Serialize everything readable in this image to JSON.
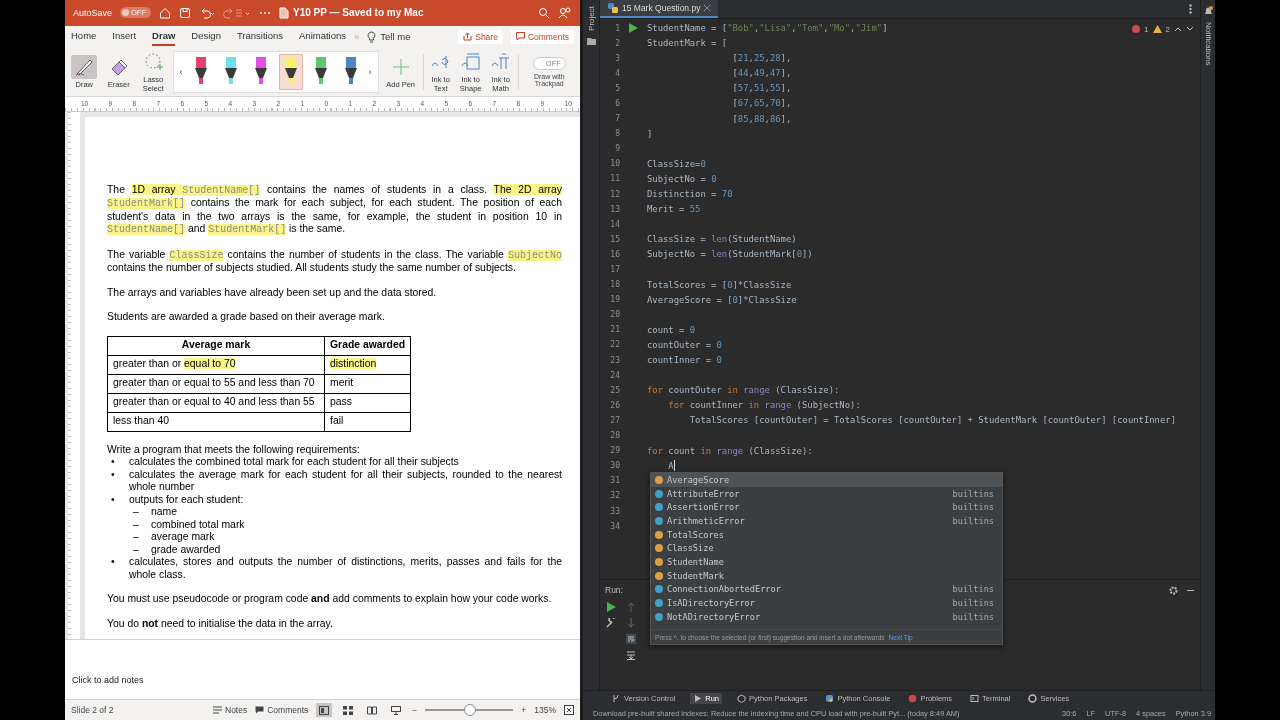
{
  "presentation": {
    "title_bar": {
      "autosave_label": "AutoSave",
      "autosave_toggle": {
        "label": "OFF",
        "on": false
      },
      "title": "Y10 PP — Saved to my Mac"
    },
    "tabs": [
      {
        "label": "Home",
        "selected": false
      },
      {
        "label": "Insert",
        "selected": false
      },
      {
        "label": "Draw",
        "selected": true
      },
      {
        "label": "Design",
        "selected": false
      },
      {
        "label": "Transitions",
        "selected": false
      },
      {
        "label": "Animations",
        "selected": false
      }
    ],
    "tabs_overflow": "»",
    "tell_me": "Tell me",
    "share": "Share",
    "comments": "Comments",
    "ribbon": {
      "tools": [
        {
          "kind": "draw",
          "label": "Draw",
          "selected": true
        },
        {
          "kind": "eraser",
          "label": "Eraser",
          "selected": false
        },
        {
          "kind": "lasso",
          "label": "Lasso Select",
          "selected": false
        }
      ],
      "pens": [
        {
          "color": "#e8416f",
          "selected": false
        },
        {
          "color": "#6fe0ea",
          "selected": false
        },
        {
          "color": "#e24de8",
          "selected": false
        },
        {
          "color": "#f7f267",
          "selected": true
        },
        {
          "color": "#5cc66a",
          "selected": false
        },
        {
          "color": "#4a86c6",
          "selected": false
        }
      ],
      "pen_scroll_left": "‹",
      "pen_scroll_right": "›",
      "add_pen": "Add Pen",
      "ink_tools": [
        {
          "kind": "text",
          "label": "Ink to Text"
        },
        {
          "kind": "shape",
          "label": "Ink to Shape"
        },
        {
          "kind": "math",
          "label": "Ink to Math"
        }
      ],
      "trackpad_toggle": {
        "label": "OFF",
        "on": false
      },
      "trackpad_label": "Draw with Trackpad"
    },
    "ruler": [
      "10",
      "9",
      "8",
      "7",
      "6",
      "5",
      "4",
      "3",
      "2",
      "1",
      "0",
      "1",
      "2",
      "3",
      "4",
      "5",
      "6",
      "7",
      "8",
      "9",
      "10"
    ],
    "slide": {
      "paragraphs": [
        [
          {
            "kind": "text",
            "text": "The ",
            "highlighted": false
          },
          {
            "kind": "text",
            "text": "1D array ",
            "highlighted": true
          },
          {
            "kind": "code",
            "text": "StudentName[]",
            "highlighted": true
          },
          {
            "kind": "text",
            "text": " contains the names of students in a class. ",
            "highlighted": false
          },
          {
            "kind": "text",
            "text": "The 2D array ",
            "highlighted": true
          },
          {
            "kind": "code",
            "text": "StudentMark[]",
            "highlighted": true
          },
          {
            "kind": "text",
            "text": " contains the mark for each subject, for each student. The position of each student's data in the two arrays is the same, for example, the student in position 10 in ",
            "highlighted": false
          },
          {
            "kind": "code",
            "text": "StudentName[]",
            "highlighted": true
          },
          {
            "kind": "text",
            "text": " and ",
            "highlighted": false
          },
          {
            "kind": "code",
            "text": "StudentMark[]",
            "highlighted": true
          },
          {
            "kind": "text",
            "text": " is the same.",
            "highlighted": false
          }
        ],
        [
          {
            "kind": "text",
            "text": "The variable ",
            "highlighted": false
          },
          {
            "kind": "code",
            "text": "ClassSize",
            "highlighted": true
          },
          {
            "kind": "text",
            "text": " contains the number of students in the class. The variable ",
            "highlighted": false
          },
          {
            "kind": "code",
            "text": "SubjectNo",
            "highlighted": true
          },
          {
            "kind": "text",
            "text": " contains the number of subjects studied. All students study the same number of subjects.",
            "highlighted": false
          }
        ],
        [
          {
            "kind": "text",
            "text": "The arrays and variables have already been set up and the data stored.",
            "highlighted": false
          }
        ],
        [
          {
            "kind": "text",
            "text": "Students are awarded a grade based on their average mark.",
            "highlighted": false
          }
        ]
      ],
      "table": {
        "columns": [
          "Average mark",
          "Grade awarded"
        ],
        "rows": [
          [
            [
              {
                "kind": "text",
                "text": "greater than or ",
                "highlighted": false
              },
              {
                "kind": "text",
                "text": "equal to 70",
                "highlighted": true
              }
            ],
            [
              {
                "kind": "text",
                "text": "distinction",
                "highlighted": true
              }
            ]
          ],
          [
            [
              {
                "kind": "text",
                "text": "greater than or equal to 55 and less than 70",
                "highlighted": false
              }
            ],
            [
              {
                "kind": "text",
                "text": "merit",
                "highlighted": false
              }
            ]
          ],
          [
            [
              {
                "kind": "text",
                "text": "greater than or equal to 40 and less than 55",
                "highlighted": false
              }
            ],
            [
              {
                "kind": "text",
                "text": "pass",
                "highlighted": false
              }
            ]
          ],
          [
            [
              {
                "kind": "text",
                "text": "less than 40",
                "highlighted": false
              }
            ],
            [
              {
                "kind": "text",
                "text": "fail",
                "highlighted": false
              }
            ]
          ]
        ]
      },
      "requirements": {
        "intro": "Write a program that meets the following requirements:",
        "items": [
          {
            "marker": "•",
            "text": "calculates the combined total mark for each student for all their subjects"
          },
          {
            "marker": "•",
            "text": "calculates the average mark for each student for all their subjects, rounded to the nearest whole number"
          },
          {
            "marker": "•",
            "text": "outputs for each student:",
            "children": [
              {
                "marker": "–",
                "text": "name"
              },
              {
                "marker": "–",
                "text": "combined total mark"
              },
              {
                "marker": "–",
                "text": "average mark"
              },
              {
                "marker": "–",
                "text": "grade awarded"
              }
            ]
          },
          {
            "marker": "•",
            "text": "calculates, stores and outputs the number of distinctions, merits, passes and fails for the whole class."
          }
        ]
      },
      "closing": [
        "You must use pseudocode or program code **and** add comments to explain how your code works.",
        "You do **not** need to initialise the data in the array."
      ]
    },
    "notes_placeholder": "Click to add notes",
    "status_bar": {
      "slide": "Slide 2 of 2",
      "notes": "Notes",
      "comments": "Comments",
      "views": [
        {
          "kind": "normal",
          "selected": true
        },
        {
          "kind": "sorter",
          "selected": false
        },
        {
          "kind": "reading",
          "selected": false
        },
        {
          "kind": "show",
          "selected": false
        }
      ],
      "zoom_out": "−",
      "zoom_in": "+",
      "zoom_slider": {
        "level": 0.5
      },
      "zoom": "135%"
    }
  },
  "ide": {
    "side_left": "Project",
    "side_right": "Notifications",
    "file_tab": "15 Mark Question.py",
    "inspections": {
      "errors": "1",
      "warnings": "2"
    },
    "code_lines": [
      {
        "number": "1",
        "tokens": [
          {
            "kind": "plain",
            "text": "StudentName = ["
          },
          {
            "kind": "string",
            "text": "\"Bob\""
          },
          {
            "kind": "plain",
            "text": ","
          },
          {
            "kind": "string",
            "text": "\"Lisa\""
          },
          {
            "kind": "plain",
            "text": ","
          },
          {
            "kind": "string",
            "text": "\"Tom\""
          },
          {
            "kind": "plain",
            "text": ","
          },
          {
            "kind": "string",
            "text": "\"Mo\""
          },
          {
            "kind": "plain",
            "text": ","
          },
          {
            "kind": "string",
            "text": "\"Jim\""
          },
          {
            "kind": "plain",
            "text": "]"
          }
        ]
      },
      {
        "number": "2",
        "tokens": [
          {
            "kind": "plain",
            "text": "StudentMark = ["
          }
        ]
      },
      {
        "number": "3",
        "tokens": [
          {
            "kind": "plain",
            "text": "                ["
          },
          {
            "kind": "number",
            "text": "21"
          },
          {
            "kind": "plain",
            "text": ","
          },
          {
            "kind": "number",
            "text": "25"
          },
          {
            "kind": "plain",
            "text": ","
          },
          {
            "kind": "number",
            "text": "28"
          },
          {
            "kind": "plain",
            "text": "],"
          }
        ]
      },
      {
        "number": "4",
        "tokens": [
          {
            "kind": "plain",
            "text": "                ["
          },
          {
            "kind": "number",
            "text": "44"
          },
          {
            "kind": "plain",
            "text": ","
          },
          {
            "kind": "number",
            "text": "49"
          },
          {
            "kind": "plain",
            "text": ","
          },
          {
            "kind": "number",
            "text": "47"
          },
          {
            "kind": "plain",
            "text": "],"
          }
        ]
      },
      {
        "number": "5",
        "tokens": [
          {
            "kind": "plain",
            "text": "                ["
          },
          {
            "kind": "number",
            "text": "57"
          },
          {
            "kind": "plain",
            "text": ","
          },
          {
            "kind": "number",
            "text": "51"
          },
          {
            "kind": "plain",
            "text": ","
          },
          {
            "kind": "number",
            "text": "55"
          },
          {
            "kind": "plain",
            "text": "],"
          }
        ]
      },
      {
        "number": "6",
        "tokens": [
          {
            "kind": "plain",
            "text": "                ["
          },
          {
            "kind": "number",
            "text": "67"
          },
          {
            "kind": "plain",
            "text": ","
          },
          {
            "kind": "number",
            "text": "65"
          },
          {
            "kind": "plain",
            "text": ","
          },
          {
            "kind": "number",
            "text": "70"
          },
          {
            "kind": "plain",
            "text": "],"
          }
        ]
      },
      {
        "number": "7",
        "tokens": [
          {
            "kind": "plain",
            "text": "                ["
          },
          {
            "kind": "number",
            "text": "85"
          },
          {
            "kind": "plain",
            "text": ","
          },
          {
            "kind": "number",
            "text": "88"
          },
          {
            "kind": "plain",
            "text": ","
          },
          {
            "kind": "number",
            "text": "86"
          },
          {
            "kind": "plain",
            "text": "],"
          }
        ]
      },
      {
        "number": "8",
        "tokens": [
          {
            "kind": "plain",
            "text": "]"
          }
        ]
      },
      {
        "number": "9"
      },
      {
        "number": "10",
        "tokens": [
          {
            "kind": "plain",
            "text": "ClassSize="
          },
          {
            "kind": "number",
            "text": "0"
          }
        ]
      },
      {
        "number": "11",
        "tokens": [
          {
            "kind": "plain",
            "text": "SubjectNo = "
          },
          {
            "kind": "number",
            "text": "0"
          }
        ]
      },
      {
        "number": "12",
        "tokens": [
          {
            "kind": "plain",
            "text": "Distinction = "
          },
          {
            "kind": "number",
            "text": "70"
          }
        ]
      },
      {
        "number": "13",
        "tokens": [
          {
            "kind": "plain",
            "text": "Merit = "
          },
          {
            "kind": "number",
            "text": "55"
          }
        ]
      },
      {
        "number": "14"
      },
      {
        "number": "15",
        "tokens": [
          {
            "kind": "plain",
            "text": "ClassSize = "
          },
          {
            "kind": "builtin",
            "text": "len"
          },
          {
            "kind": "plain",
            "text": "(StudentName)"
          }
        ]
      },
      {
        "number": "16",
        "tokens": [
          {
            "kind": "plain",
            "text": "SubjectNo = "
          },
          {
            "kind": "builtin",
            "text": "len"
          },
          {
            "kind": "plain",
            "text": "(StudentMark["
          },
          {
            "kind": "number",
            "text": "0"
          },
          {
            "kind": "plain",
            "text": "])"
          }
        ]
      },
      {
        "number": "17"
      },
      {
        "number": "18",
        "tokens": [
          {
            "kind": "plain",
            "text": "TotalScores = ["
          },
          {
            "kind": "number",
            "text": "0"
          },
          {
            "kind": "plain",
            "text": "]*ClassSize"
          }
        ]
      },
      {
        "number": "19",
        "tokens": [
          {
            "kind": "plain",
            "text": "AverageScore = ["
          },
          {
            "kind": "number",
            "text": "0"
          },
          {
            "kind": "plain",
            "text": "]*ClassSize"
          }
        ]
      },
      {
        "number": "20"
      },
      {
        "number": "21",
        "tokens": [
          {
            "kind": "plain",
            "text": "count = "
          },
          {
            "kind": "number",
            "text": "0"
          }
        ]
      },
      {
        "number": "22",
        "tokens": [
          {
            "kind": "plain",
            "text": "countOuter = "
          },
          {
            "kind": "number",
            "text": "0"
          }
        ]
      },
      {
        "number": "23",
        "tokens": [
          {
            "kind": "plain",
            "text": "countInner = "
          },
          {
            "kind": "number",
            "text": "0"
          }
        ]
      },
      {
        "number": "24"
      },
      {
        "number": "25",
        "tokens": [
          {
            "kind": "keyword",
            "text": "for"
          },
          {
            "kind": "plain",
            "text": " countOuter "
          },
          {
            "kind": "keyword",
            "text": "in"
          },
          {
            "kind": "builtin",
            "text": " range"
          },
          {
            "kind": "plain",
            "text": " (ClassSize):"
          }
        ]
      },
      {
        "number": "26",
        "tokens": [
          {
            "kind": "keyword",
            "text": "    for"
          },
          {
            "kind": "plain",
            "text": " countInner "
          },
          {
            "kind": "keyword",
            "text": "in"
          },
          {
            "kind": "builtin",
            "text": " range"
          },
          {
            "kind": "plain",
            "text": " (SubjectNo):"
          }
        ]
      },
      {
        "number": "27",
        "tokens": [
          {
            "kind": "plain",
            "text": "        TotalScores [countOuter] = TotalScores [countOuter] + StudentMark [countOuter] [countInner]"
          }
        ]
      },
      {
        "number": "28"
      },
      {
        "number": "29",
        "tokens": [
          {
            "kind": "keyword",
            "text": "for"
          },
          {
            "kind": "plain",
            "text": " count "
          },
          {
            "kind": "keyword",
            "text": "in"
          },
          {
            "kind": "builtin",
            "text": " range"
          },
          {
            "kind": "plain",
            "text": " (ClassSize):"
          }
        ]
      },
      {
        "number": "30",
        "tokens": [
          {
            "kind": "plain",
            "text": "    A"
          }
        ]
      },
      {
        "number": "31"
      },
      {
        "number": "32"
      },
      {
        "number": "33"
      },
      {
        "number": "34"
      }
    ],
    "completion": {
      "items": [
        {
          "kind": "variable",
          "name": "AverageScore",
          "selected": true
        },
        {
          "kind": "class",
          "name": "AttributeError",
          "source": "builtins",
          "selected": false
        },
        {
          "kind": "class",
          "name": "AssertionError",
          "source": "builtins",
          "selected": false
        },
        {
          "kind": "class",
          "name": "ArithmeticError",
          "source": "builtins",
          "selected": false
        },
        {
          "kind": "variable",
          "name": "TotalScores",
          "selected": false
        },
        {
          "kind": "variable",
          "name": "ClassSize",
          "selected": false
        },
        {
          "kind": "variable",
          "name": "StudentName",
          "selected": false
        },
        {
          "kind": "variable",
          "name": "StudentMark",
          "selected": false
        },
        {
          "kind": "class",
          "name": "ConnectionAbortedError",
          "source": "builtins",
          "selected": false
        },
        {
          "kind": "class",
          "name": "IsADirectoryError",
          "source": "builtins",
          "selected": false
        },
        {
          "kind": "class",
          "name": "NotADirectoryError",
          "source": "builtins",
          "selected": false
        }
      ],
      "hint": "Press ^. to choose the selected (or first) suggestion and insert a dot afterwards",
      "next_tip": "Next Tip"
    },
    "run_panel": {
      "label": "Run:"
    },
    "tool_tabs": [
      {
        "kind": "vcs",
        "label": "Version Control",
        "selected": false
      },
      {
        "kind": "run",
        "label": "Run",
        "selected": true
      },
      {
        "kind": "packages",
        "label": "Python Packages",
        "selected": false
      },
      {
        "kind": "console",
        "label": "Python Console",
        "selected": false
      },
      {
        "kind": "problems",
        "label": "Problems",
        "selected": false
      },
      {
        "kind": "terminal",
        "label": "Terminal",
        "selected": false
      },
      {
        "kind": "services",
        "label": "Services",
        "selected": false
      }
    ],
    "status": {
      "message": "Download pre-built shared indexes: Reduce the indexing time and CPU load with pre-built Pyt... (today 8:49 AM)",
      "items": [
        "30:6",
        "LF",
        "UTF-8",
        "4 spaces",
        "Python 3.9"
      ]
    }
  }
}
